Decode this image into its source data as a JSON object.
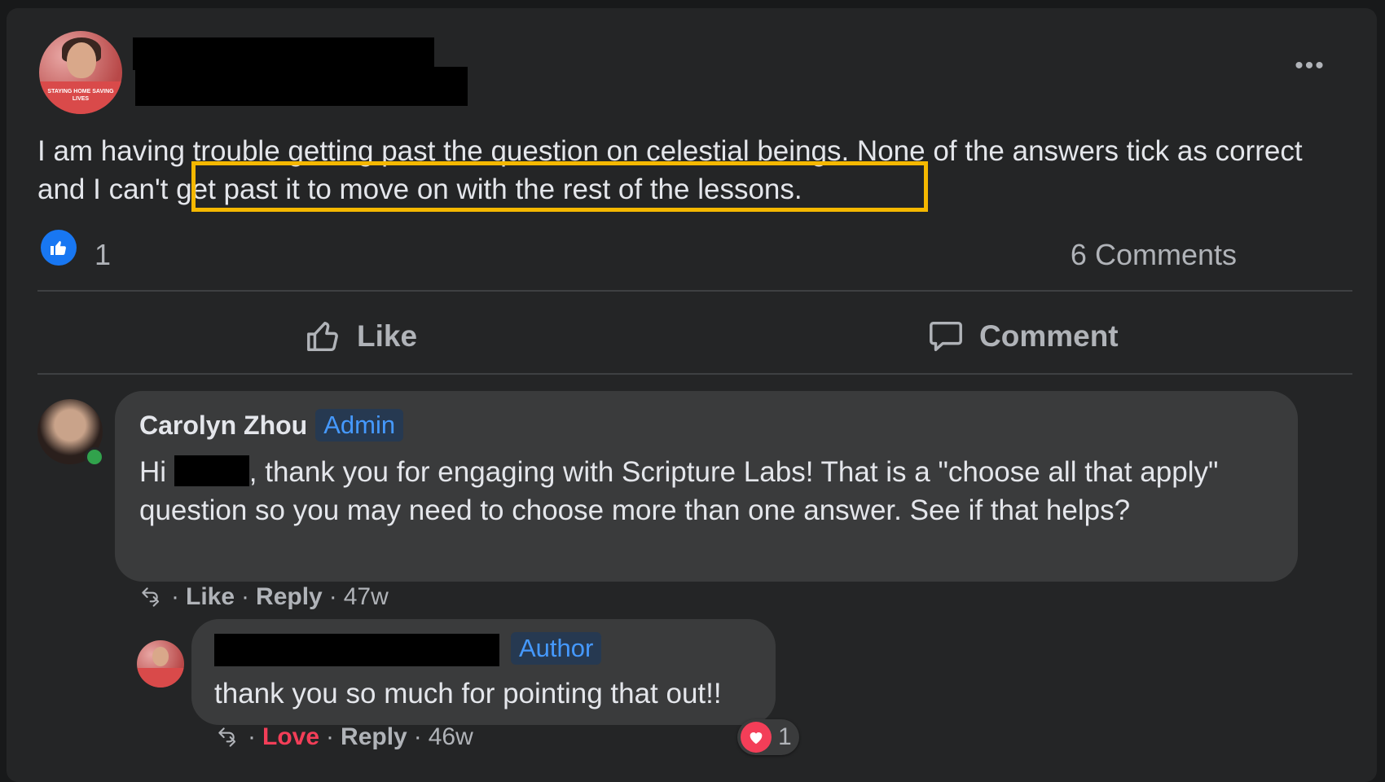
{
  "post": {
    "text_before": "I am having trouble getting past the question on celestial beings.  None of the answers tick as correct and ",
    "text_highlighted": "I can't get past it to move on with the rest of the lessons.",
    "avatar_banner": "STAYING HOME SAVING LIVES",
    "more_icon": "more-options-icon",
    "like_count": "1",
    "comments_count": "6 Comments"
  },
  "actions": {
    "like_label": "Like",
    "comment_label": "Comment"
  },
  "comments": [
    {
      "author": "Carolyn Zhou",
      "badge": "Admin",
      "text_before": "Hi ",
      "text_after": ", thank you for engaging with Scripture Labs! That is a \"choose all that apply\" question so you may need to choose more than one answer. See if that helps?",
      "action_like": "Like",
      "action_reply": "Reply",
      "time": "47w"
    },
    {
      "badge": "Author",
      "text": "thank you so much for pointing that out!!",
      "action_like": "Love",
      "action_reply": "Reply",
      "time": "46w",
      "reaction_count": "1"
    }
  ],
  "colors": {
    "highlight": "#f5b800",
    "like_blue": "#1877f2",
    "love_red": "#f33e58",
    "admin_blue": "#4599ff",
    "online_green": "#31a24c"
  }
}
